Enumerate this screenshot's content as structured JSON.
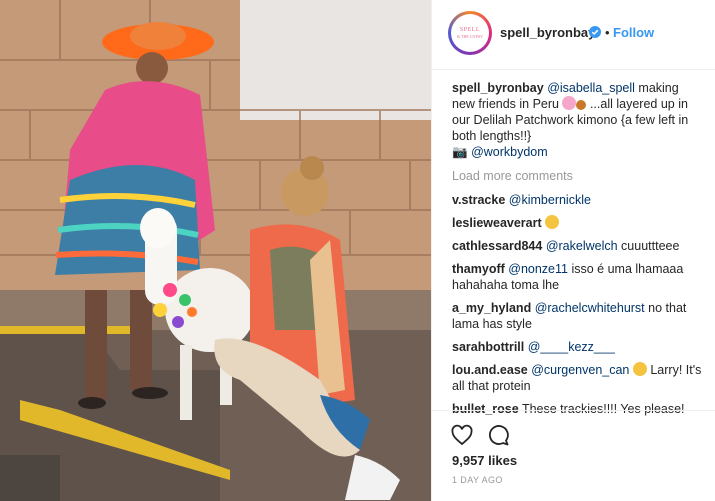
{
  "header": {
    "avatar_logo": [
      "SPELL",
      "& THE GYPSY"
    ],
    "username": "spell_byronbay",
    "verified": true,
    "separator": "•",
    "follow_label": "Follow"
  },
  "caption": {
    "username": "spell_byronbay",
    "mention": "@isabella_spell",
    "text1": " making new friends in Peru ",
    "text2": " ...all layered up in our Delilah Patchwork kimono {a few left in both lengths!!}",
    "camera_emoji": "📷",
    "credit": "@workbydom"
  },
  "load_more_label": "Load more comments",
  "comments": [
    {
      "user": "v.stracke",
      "mention": "@kimbernickle",
      "text": ""
    },
    {
      "user": "leslieweaverart",
      "mention": "",
      "text": ""
    },
    {
      "user": "cathlessard844",
      "mention": "@rakelwelch",
      "text": " cuuuttteee"
    },
    {
      "user": "thamyoff",
      "mention": "@nonze11",
      "text": " isso é uma lhamaaa hahahaha toma lhe"
    },
    {
      "user": "a_my_hyland",
      "mention": "@rachelcwhitehurst",
      "text": " no that lama has style"
    },
    {
      "user": "sarahbottrill",
      "mention": "@____kezz___",
      "text": ""
    },
    {
      "user": "lou.and.ease",
      "mention": "@curgenven_can",
      "text": " Larry! It's all that protein"
    },
    {
      "user": "bullet_rose",
      "mention": "",
      "text": "These trackies!!!! Yes please!"
    }
  ],
  "likes": "9,957 likes",
  "time_ago": "1 DAY AGO",
  "colors": {
    "accent": "#3897f0",
    "mention": "#003569",
    "muted": "#999999"
  }
}
